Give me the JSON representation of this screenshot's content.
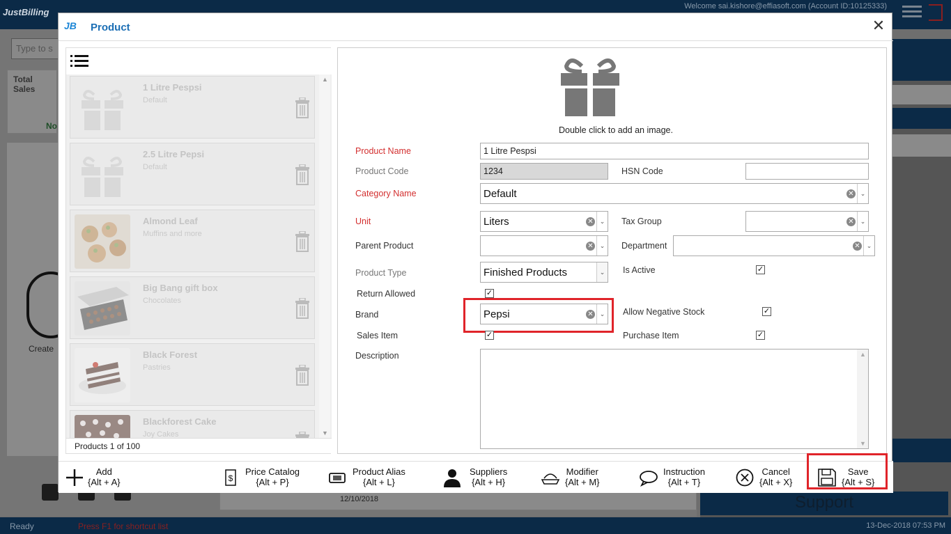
{
  "background": {
    "app_name": "JustBilling",
    "welcome": "Welcome sai.kishore@effiasoft.com (Account ID:10125333)",
    "search_placeholder": "Type to s",
    "total_sales": "Total Sales",
    "no_label": "No",
    "create_label": "Create",
    "support_label": "Support",
    "date_value": "12/10/2018",
    "status_ready": "Ready",
    "status_f1": "Press F1 for shortcut list",
    "clock": "13-Dec-2018 07:53 PM"
  },
  "dialog": {
    "logo": "JB",
    "title": "Product",
    "close_glyph": "✕"
  },
  "product_list": {
    "items": [
      {
        "name": "1 Litre Pespsi",
        "category": "Default",
        "image": "gift-icon"
      },
      {
        "name": "2.5 Litre Pepsi",
        "category": "Default",
        "image": "gift-icon"
      },
      {
        "name": "Almond Leaf",
        "category": "Muffins and more",
        "image": "muffins-photo"
      },
      {
        "name": "Big Bang gift box",
        "category": "Chocolates",
        "image": "chocolate-box-photo"
      },
      {
        "name": "Black Forest",
        "category": "Pastries",
        "image": "cake-slice-photo"
      },
      {
        "name": "Blackforest Cake",
        "category": "Joy Cakes",
        "image": "cake-photo"
      }
    ],
    "footer": "Products 1 of 100"
  },
  "form": {
    "image_hint": "Double click to add an image.",
    "product_name_label": "Product Name",
    "product_name_value": "1 Litre Pespsi",
    "product_code_label": "Product Code",
    "product_code_value": "1234",
    "hsn_code_label": "HSN Code",
    "hsn_code_value": "",
    "category_label": "Category Name",
    "category_value": "Default",
    "unit_label": "Unit",
    "unit_value": "Liters",
    "tax_group_label": "Tax Group",
    "tax_group_value": "",
    "parent_product_label": "Parent Product",
    "parent_product_value": "",
    "department_label": "Department",
    "department_value": "",
    "product_type_label": "Product Type",
    "product_type_value": "Finished Products",
    "is_active_label": "Is Active",
    "is_active": true,
    "return_allowed_label": "Return Allowed",
    "return_allowed": true,
    "brand_label": "Brand",
    "brand_value": "Pepsi",
    "allow_negative_label": "Allow Negative Stock",
    "allow_negative": true,
    "sales_item_label": "Sales Item",
    "sales_item": true,
    "purchase_item_label": "Purchase Item",
    "purchase_item": true,
    "description_label": "Description",
    "description_value": "",
    "check_glyph": "✓",
    "clear_glyph": "✕",
    "arrow_glyph": "⌄"
  },
  "toolbar": {
    "add": {
      "label": "Add",
      "shortcut": "{Alt + A}",
      "icon": "plus-icon"
    },
    "price_catalog": {
      "label": "Price Catalog",
      "shortcut": "{Alt + P}",
      "icon": "price-tag-icon"
    },
    "product_alias": {
      "label": "Product Alias",
      "shortcut": "{Alt + L}",
      "icon": "alias-tag-icon"
    },
    "suppliers": {
      "label": "Suppliers",
      "shortcut": "{Alt + H}",
      "icon": "supplier-person-icon"
    },
    "modifier": {
      "label": "Modifier",
      "shortcut": "{Alt + M}",
      "icon": "modifier-dish-icon"
    },
    "instruction": {
      "label": "Instruction",
      "shortcut": "{Alt + T}",
      "icon": "instruction-chat-icon"
    },
    "cancel": {
      "label": "Cancel",
      "shortcut": "{Alt + X}",
      "icon": "cancel-circle-icon"
    },
    "save": {
      "label": "Save",
      "shortcut": "{Alt + S}",
      "icon": "save-disk-icon"
    }
  },
  "colors": {
    "accent": "#1c6fb5",
    "required_label": "#d32f2f",
    "highlight": "#e0242a",
    "app_bar": "#0b2a47"
  }
}
